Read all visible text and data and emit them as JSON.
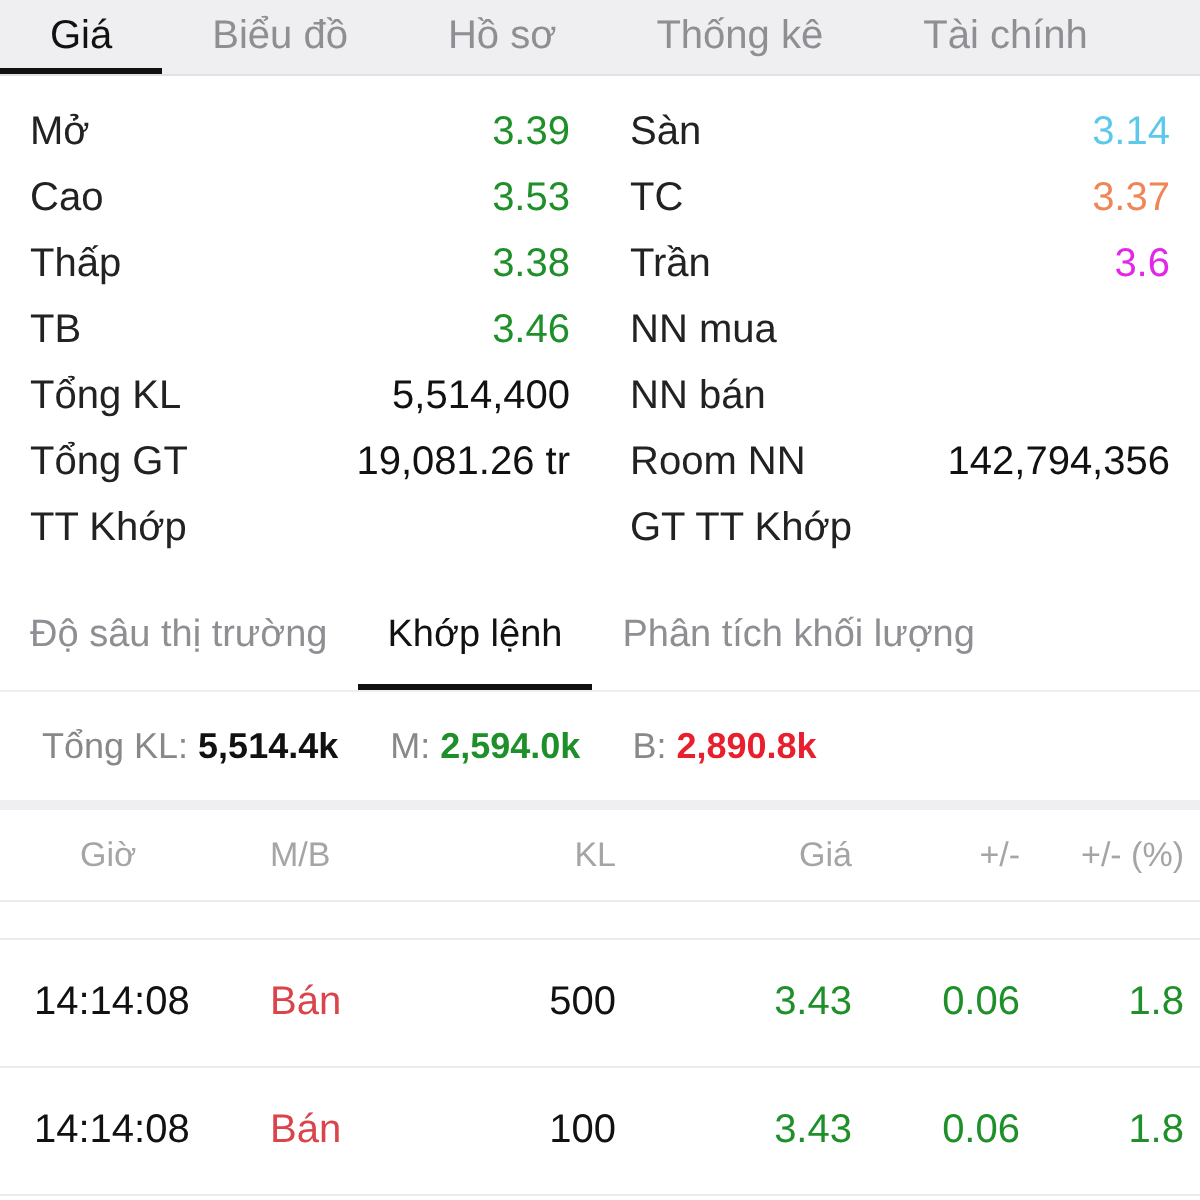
{
  "tabs": [
    {
      "label": "Giá",
      "selected": true
    },
    {
      "label": "Biểu đồ",
      "selected": false
    },
    {
      "label": "Hồ sơ",
      "selected": false
    },
    {
      "label": "Thống kê",
      "selected": false
    },
    {
      "label": "Tài chính",
      "selected": false
    }
  ],
  "stats": {
    "left": [
      {
        "label": "Mở",
        "value": "3.39",
        "color": "#1f8f2a"
      },
      {
        "label": "Cao",
        "value": "3.53",
        "color": "#1f8f2a"
      },
      {
        "label": "Thấp",
        "value": "3.38",
        "color": "#1f8f2a"
      },
      {
        "label": "TB",
        "value": "3.46",
        "color": "#1f8f2a"
      },
      {
        "label": "Tổng KL",
        "value": "5,514,400",
        "color": "#111111"
      },
      {
        "label": "Tổng GT",
        "value": "19,081.26 tr",
        "color": "#111111"
      },
      {
        "label": "TT Khớp"
      }
    ],
    "right": [
      {
        "label": "Sàn",
        "value": "3.14",
        "color": "#5cc8ea"
      },
      {
        "label": "TC",
        "value": "3.37",
        "color": "#f08656"
      },
      {
        "label": "Trần",
        "value": "3.6",
        "color": "#e227e8"
      },
      {
        "label": "NN mua"
      },
      {
        "label": "NN bán"
      },
      {
        "label": "Room NN",
        "value": "142,794,356",
        "color": "#111111"
      },
      {
        "label": "GT TT Khớp"
      }
    ]
  },
  "sub_tabs": [
    {
      "label": "Độ sâu thị trường",
      "selected": false
    },
    {
      "label": "Khớp lệnh",
      "selected": true
    },
    {
      "label": "Phân tích khối lượng",
      "selected": false
    }
  ],
  "summary": [
    {
      "label": "Tổng KL:",
      "value": "5,514.4k",
      "color": "#111111"
    },
    {
      "label": "M:",
      "value": "2,594.0k",
      "color": "#1f8f2a"
    },
    {
      "label": "B:",
      "value": "2,890.8k",
      "color": "#e8202e"
    }
  ],
  "trades": {
    "columns": [
      "Giờ",
      "M/B",
      "KL",
      "Giá",
      "+/-",
      "+/- (%)"
    ],
    "rows": [
      {
        "time": "14:14:08",
        "kind": "sell",
        "side_label": "Bán",
        "volume": "500",
        "price": "3.43",
        "change": "0.06",
        "change_pct": "1.8",
        "color": "#1f8f2a"
      },
      {
        "time": "14:14:08",
        "kind": "sell",
        "side_label": "Bán",
        "volume": "100",
        "price": "3.43",
        "change": "0.06",
        "change_pct": "1.8",
        "color": "#1f8f2a"
      }
    ]
  }
}
